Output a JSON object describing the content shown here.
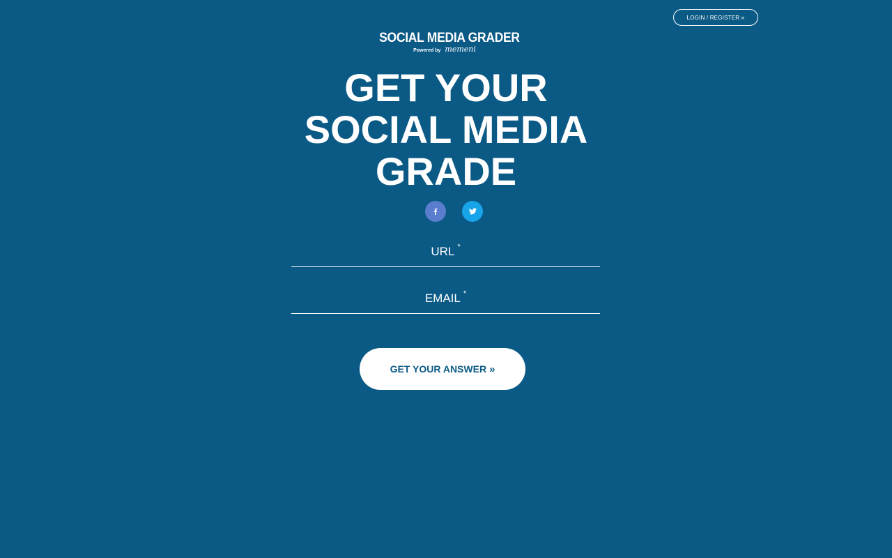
{
  "header": {
    "login_label": "LOGIN / REGISTER",
    "login_icon": "double-chevron-right-icon"
  },
  "logo": {
    "title": "SOCIAL MEDIA GRADER",
    "powered_by": "Powered by",
    "brand": "memeni"
  },
  "hero": {
    "line1": "GET YOUR",
    "line2": "SOCIAL MEDIA",
    "line3": "GRADE"
  },
  "social": {
    "facebook_icon": "facebook-icon",
    "twitter_icon": "twitter-icon",
    "facebook_color": "#5b7dce",
    "twitter_color": "#17a4e8"
  },
  "form": {
    "url_label": "URL",
    "email_label": "EMAIL",
    "required_marker": "*",
    "url_value": "",
    "email_value": "",
    "submit_label": "GET YOUR ANSWER",
    "submit_icon": "double-chevron-right-icon"
  },
  "colors": {
    "background": "#0b5a86",
    "text": "#ffffff",
    "button_text": "#0b5a86"
  }
}
